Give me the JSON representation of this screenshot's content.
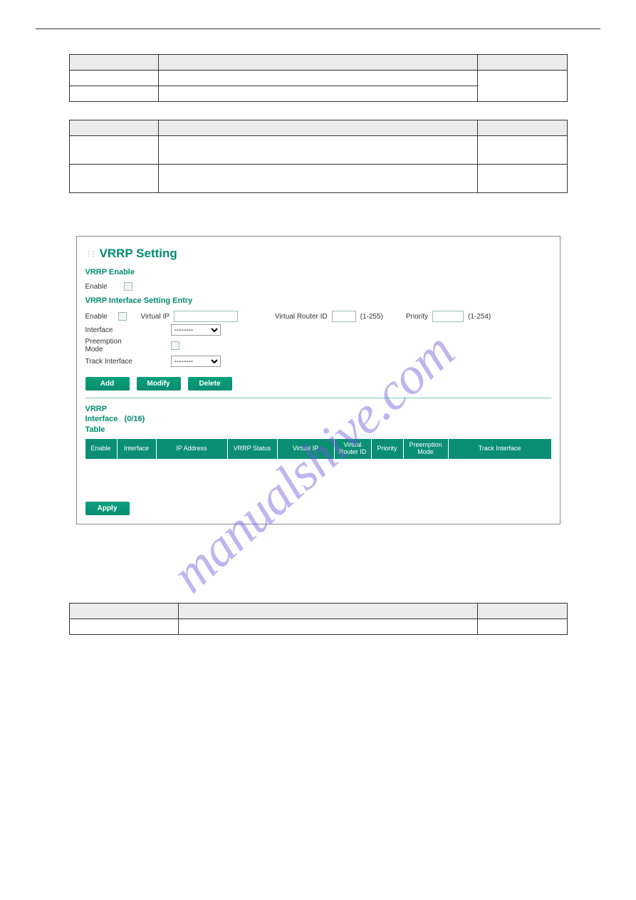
{
  "watermark": "manualshive.com",
  "doc_table1": {
    "headers": [
      "",
      "",
      ""
    ],
    "rows": [
      [
        "",
        "",
        ""
      ],
      [
        "",
        "",
        ""
      ]
    ]
  },
  "doc_table2": {
    "headers": [
      "",
      "",
      ""
    ],
    "rows": [
      [
        "",
        "",
        ""
      ],
      [
        "",
        "",
        ""
      ]
    ]
  },
  "doc_table3": {
    "headers": [
      "",
      "",
      ""
    ],
    "rows": [
      [
        "",
        "",
        ""
      ]
    ]
  },
  "panel": {
    "title": "VRRP Setting",
    "enable_section": "VRRP Enable",
    "enable_label": "Enable",
    "entry_section": "VRRP Interface Setting Entry",
    "labels": {
      "enable": "Enable",
      "virtual_ip": "Virtual IP",
      "virtual_router_id": "Virtual Router ID",
      "router_id_range": "(1-255)",
      "priority": "Priority",
      "priority_range": "(1-254)",
      "interface": "Interface",
      "preemption": "Preemption Mode",
      "track_interface": "Track Interface"
    },
    "select_placeholder": "--------",
    "buttons": {
      "add": "Add",
      "modify": "Modify",
      "delete": "Delete",
      "apply": "Apply"
    },
    "table_title": "VRRP Interface Table",
    "table_count": "(0/16)",
    "columns": [
      "Enable",
      "Interface",
      "IP Address",
      "VRRP Status",
      "Virtual IP",
      "Virtual Router ID",
      "Priority",
      "Preemption Mode",
      "Track Interface"
    ]
  }
}
